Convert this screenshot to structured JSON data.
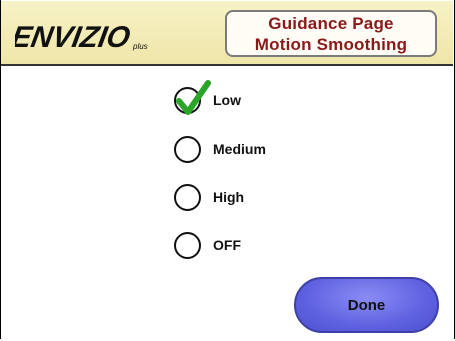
{
  "header": {
    "logo_text": "ENVIZIO",
    "logo_suffix": "plus",
    "title_line1": "Guidance Page",
    "title_line2": "Motion Smoothing"
  },
  "options": [
    {
      "label": "Low",
      "selected": true
    },
    {
      "label": "Medium",
      "selected": false
    },
    {
      "label": "High",
      "selected": false
    },
    {
      "label": "OFF",
      "selected": false
    }
  ],
  "done_label": "Done",
  "colors": {
    "header_bg": "#f2eab5",
    "title_text": "#8a1a1a",
    "check_green": "#2aa52a",
    "done_button": "#6a6cec",
    "logo": "#111111"
  }
}
